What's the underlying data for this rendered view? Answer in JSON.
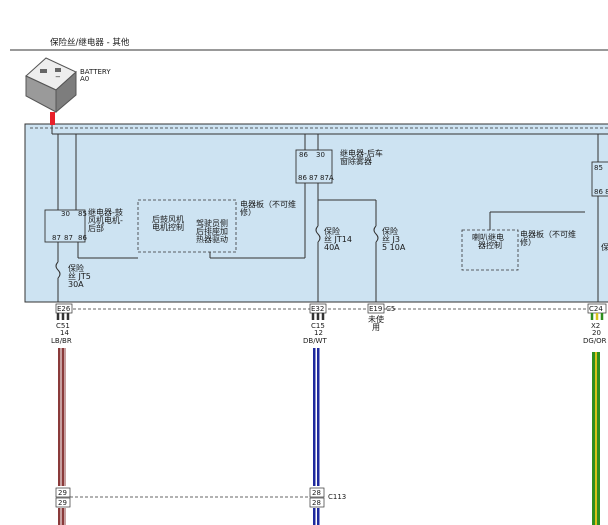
{
  "header": {
    "title": "保险丝/继电器 - 其他"
  },
  "battery": {
    "label": "BATTERY",
    "sub": "A0"
  },
  "relays": {
    "rear_defog": {
      "pins_top": [
        "86",
        "30"
      ],
      "pins_bottom": [
        "86",
        "87",
        "87A"
      ],
      "name_line1": "继电器-后车",
      "name_line2": "窗除雾器"
    },
    "rear_blower": {
      "pins_top": [
        "30",
        "85"
      ],
      "pins_bottom": [
        "87",
        "87",
        "86"
      ],
      "name_line1": "继电器-鼓",
      "name_line2": "风机电机-",
      "name_line3": "后部"
    },
    "horn": {
      "name_line1": "喇叭继电",
      "name_line2": "器控制"
    },
    "right_partial": {
      "pins_top": "85",
      "pins_bottom": "86 8"
    }
  },
  "modules": {
    "rear_blower_control": {
      "line1": "后鼓风机",
      "line2": "电机控制"
    },
    "driver_seat_heat": {
      "line1": "驾驶员侧",
      "line2": "后排座加",
      "line3": "热器驱动"
    },
    "board_note_left": {
      "line1": "电器板（不可维",
      "line2": "修）"
    },
    "board_note_right": {
      "line1": "电器板（不可维",
      "line2": "修）"
    }
  },
  "fuses": {
    "jt5": {
      "line1": "保险",
      "line2": "丝 JT5",
      "line3": "30A"
    },
    "jt14": {
      "line1": "保险",
      "line2": "丝 JT14",
      "line3": "40A"
    },
    "jt3": {
      "line1": "保险",
      "line2": "丝 J3",
      "line3": "5 10A"
    },
    "partial_right": "保"
  },
  "connectors": {
    "e26": "E26",
    "c51": "C51",
    "c51_pin": "14",
    "c51_wire": "LB/BR",
    "e32": "E32",
    "c15": "C15",
    "c15_pin": "12",
    "c15_wire": "DB/WT",
    "e19": "E19",
    "c5": "C5",
    "unused_line1": "未使",
    "unused_line2": "用",
    "c24": "C24",
    "x2": "X2",
    "x2_pin": "20",
    "x2_wire": "DG/OR",
    "c113": "C113",
    "p29": "29",
    "p28": "28"
  },
  "colors": {
    "panel_fill": "#cde3f2",
    "battery_wire": "#e8202a",
    "wire_lb_br_light": "#c7a0a0",
    "wire_lb_br_dark": "#8a3a3a",
    "wire_db_wt": "#1f2a9e",
    "wire_dg_or_green": "#2f8f1f",
    "wire_dg_or_orange": "#d8c21a"
  }
}
